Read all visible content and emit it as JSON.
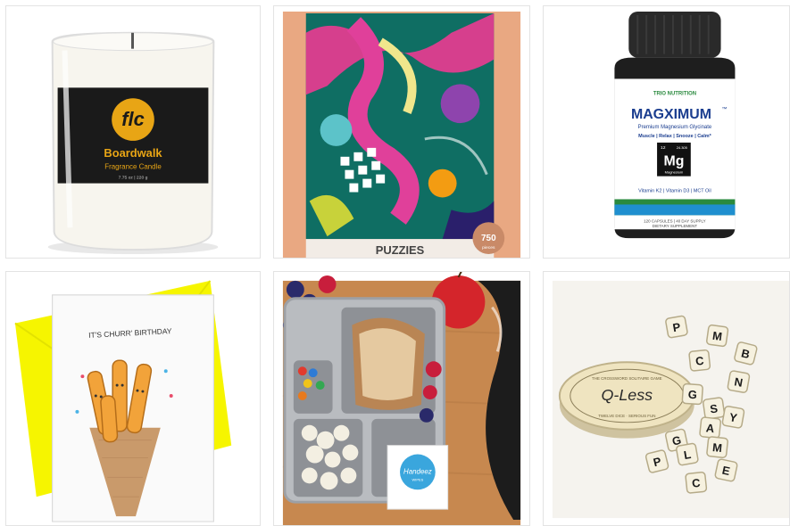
{
  "products": [
    {
      "label_main": "Boardwalk",
      "label_sub": "Fragrance Candle",
      "monogram": "flc",
      "weight": "7.75 oz | 220 g"
    },
    {
      "brand": "PUZZIES",
      "pieces_count": "750",
      "pieces_unit": "pieces"
    },
    {
      "company": "TRIO NUTRITION",
      "name": "MAGXIMUM",
      "tm": "™",
      "subtitle": "Premium Magnesium Glycinate",
      "benefits": "Muscle | Relax | Snooze | Calm*",
      "element_symbol": "Mg",
      "element_number": "12",
      "element_mass": "24.305",
      "element_name": "Magnesium",
      "vitamins": "Vitamin K2 | Vitamin D3 | MCT Oil",
      "capsules": "120 CAPSULES | 40 DAY SUPPLY",
      "supplement": "DIETARY SUPPLEMENT"
    },
    {
      "card_text": "IT'S CHURR' BIRTHDAY"
    },
    {
      "wipe_brand": "Handeez",
      "wipe_sub": "WIPES"
    },
    {
      "lid_brand": "Q-Less",
      "lid_small": "THE CROSSWORD SOLITAIRE GAME",
      "lid_bottom": "TWELVE DICE · SERIOUS FUN",
      "dice_letters": [
        "P",
        "M",
        "B",
        "C",
        "G",
        "N",
        "S",
        "G",
        "A",
        "Y",
        "P",
        "L",
        "M",
        "E",
        "C"
      ]
    }
  ],
  "colors": {
    "candle_label": "#1a1a1a",
    "candle_accent": "#e8a515",
    "puzzle_peach": "#e9a882",
    "bottle": "#1e1e1e",
    "bottle_label_blue": "#1a3d8f",
    "envelope_yellow": "#f6f500",
    "lunchbox_steel": "#b9bcc0",
    "tin_cream": "#efe4c0"
  }
}
